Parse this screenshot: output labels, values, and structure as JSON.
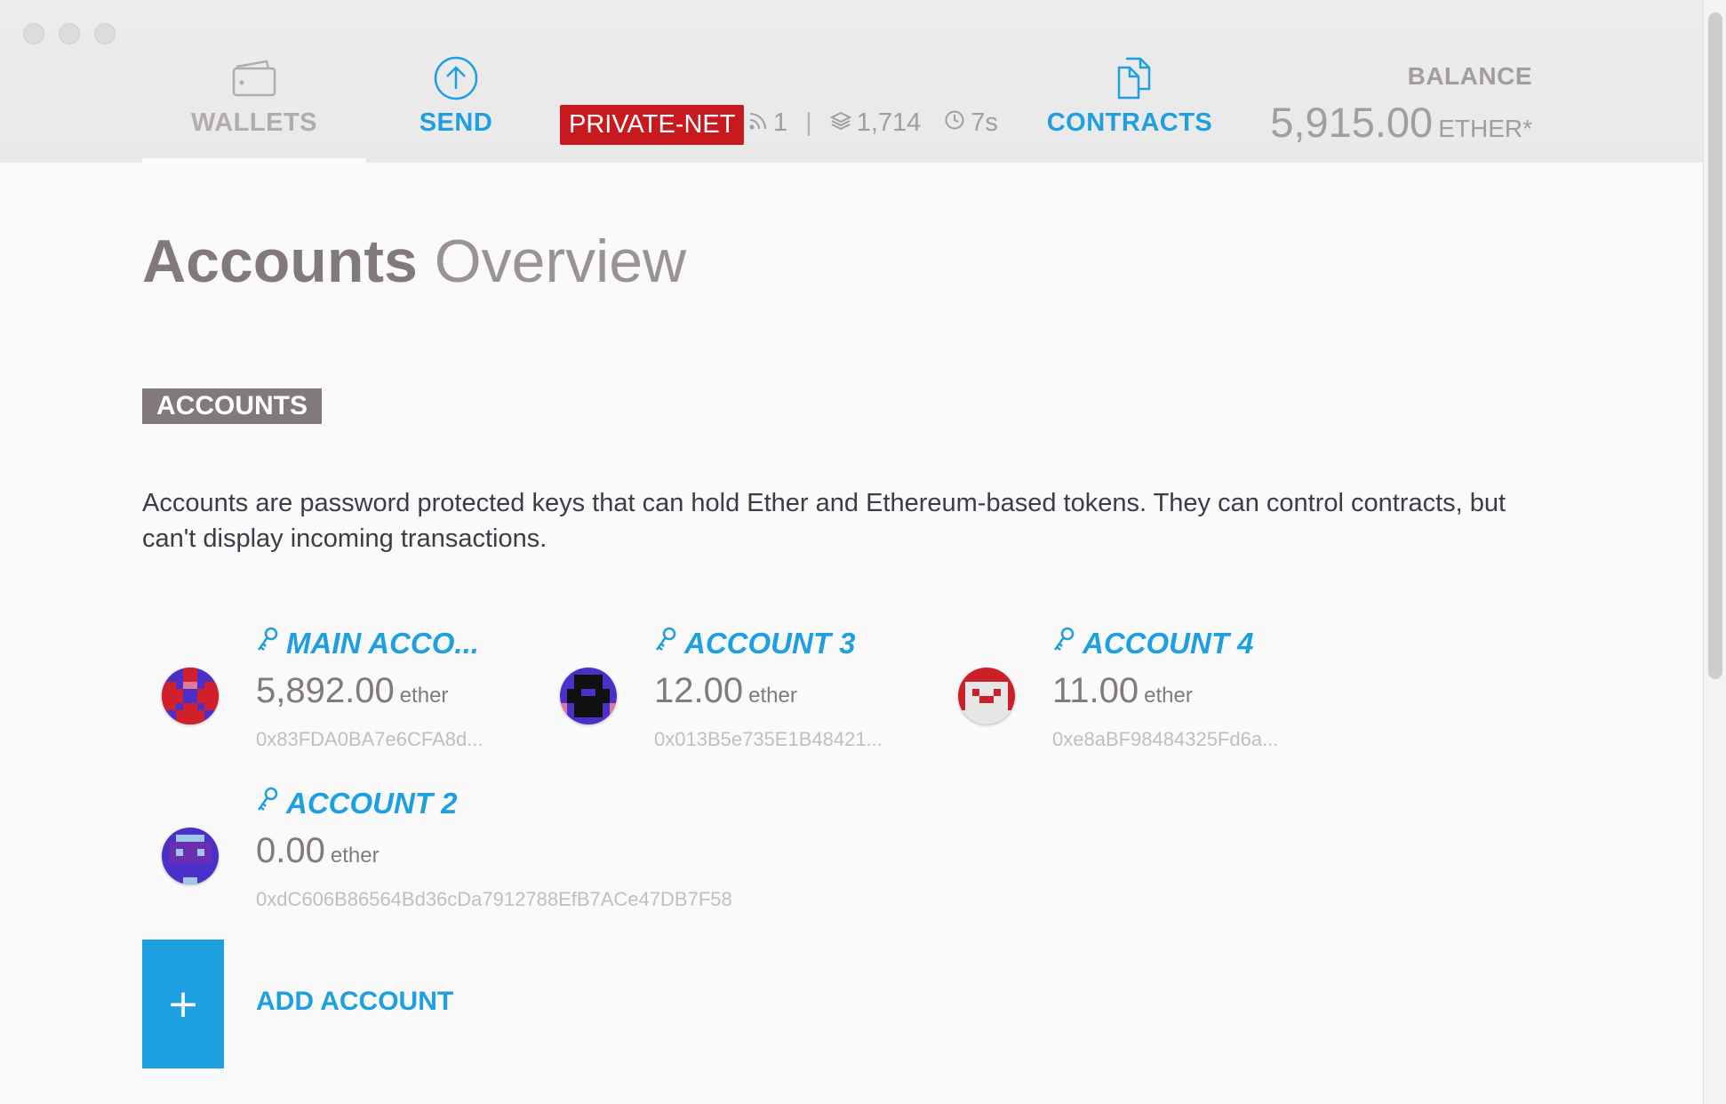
{
  "header": {
    "nav": {
      "wallets": "WALLETS",
      "send": "SEND",
      "contracts": "CONTRACTS"
    },
    "network_badge": "PRIVATE-NET",
    "peers": "1",
    "block": "1,714",
    "block_time": "7s",
    "balance_title": "BALANCE",
    "balance_value": "5,915.00",
    "balance_unit": "ETHER*"
  },
  "main": {
    "title_bold": "Accounts",
    "title_light": "Overview",
    "section_label": "ACCOUNTS",
    "description": "Accounts are password protected keys that can hold Ether and Ethereum-based tokens. They can control contracts, but can't display incoming transactions.",
    "accounts": [
      {
        "name": "MAIN ACCO...",
        "balance": "5,892.00",
        "unit": "ether",
        "address": "0x83FDA0BA7e6CFA8d..."
      },
      {
        "name": "ACCOUNT 3",
        "balance": "12.00",
        "unit": "ether",
        "address": "0x013B5e735E1B48421..."
      },
      {
        "name": "ACCOUNT 4",
        "balance": "11.00",
        "unit": "ether",
        "address": "0xe8aBF98484325Fd6a..."
      },
      {
        "name": "ACCOUNT 2",
        "balance": "0.00",
        "unit": "ether",
        "address": "0xdC606B86564Bd36cDa7912788EfB7ACe47DB7F58"
      }
    ],
    "add_button_symbol": "+",
    "add_account_label": "ADD ACCOUNT"
  },
  "colors": {
    "accent": "#1ea0e0",
    "network_badge": "#c8191f",
    "text": "#827a7a"
  }
}
